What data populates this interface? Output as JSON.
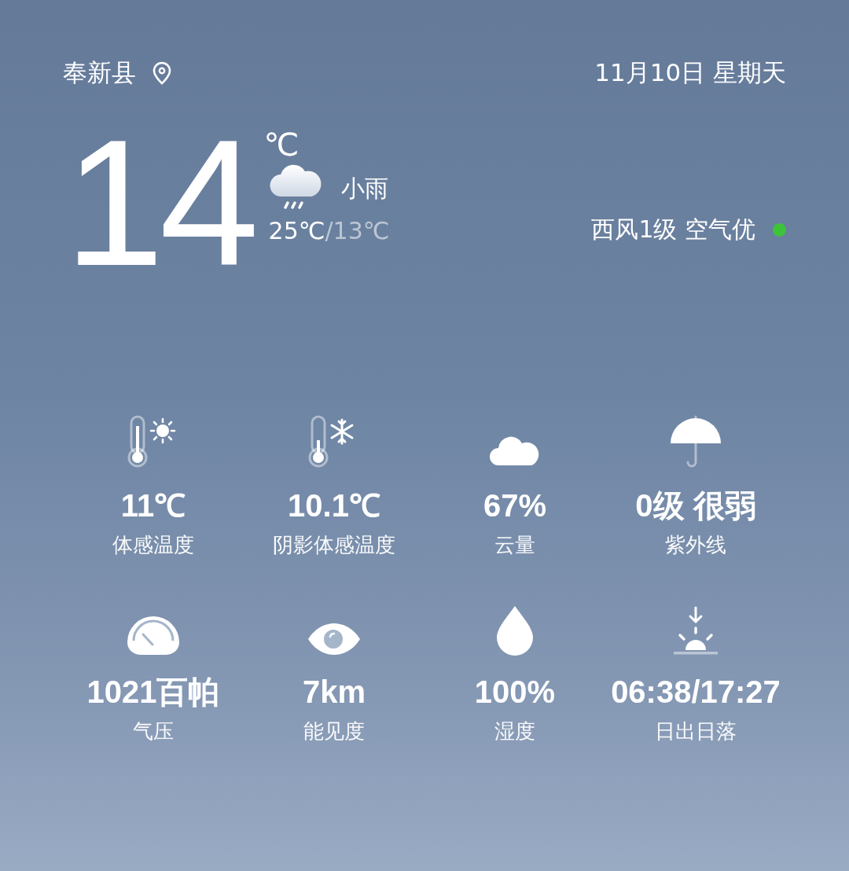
{
  "location": {
    "city": "奉新县"
  },
  "date": "11月10日 星期天",
  "current": {
    "temperature": "14",
    "unit": "℃",
    "condition": "小雨",
    "high": "25℃",
    "separator": "/",
    "low": "13℃"
  },
  "wind_air": {
    "text": "西风1级 空气优",
    "color": "#3ec43a"
  },
  "metrics": [
    {
      "kind": "feels-warm",
      "value": "11℃",
      "label": "体感温度"
    },
    {
      "kind": "feels-cold",
      "value": "10.1℃",
      "label": "阴影体感温度"
    },
    {
      "kind": "cloud",
      "value": "67%",
      "label": "云量"
    },
    {
      "kind": "umbrella",
      "value": "0级 很弱",
      "label": "紫外线"
    },
    {
      "kind": "gauge",
      "value": "1021百帕",
      "label": "气压"
    },
    {
      "kind": "eye",
      "value": "7km",
      "label": "能见度"
    },
    {
      "kind": "drop",
      "value": "100%",
      "label": "湿度"
    },
    {
      "kind": "sunset",
      "value": "06:38/17:27",
      "label": "日出日落"
    }
  ]
}
